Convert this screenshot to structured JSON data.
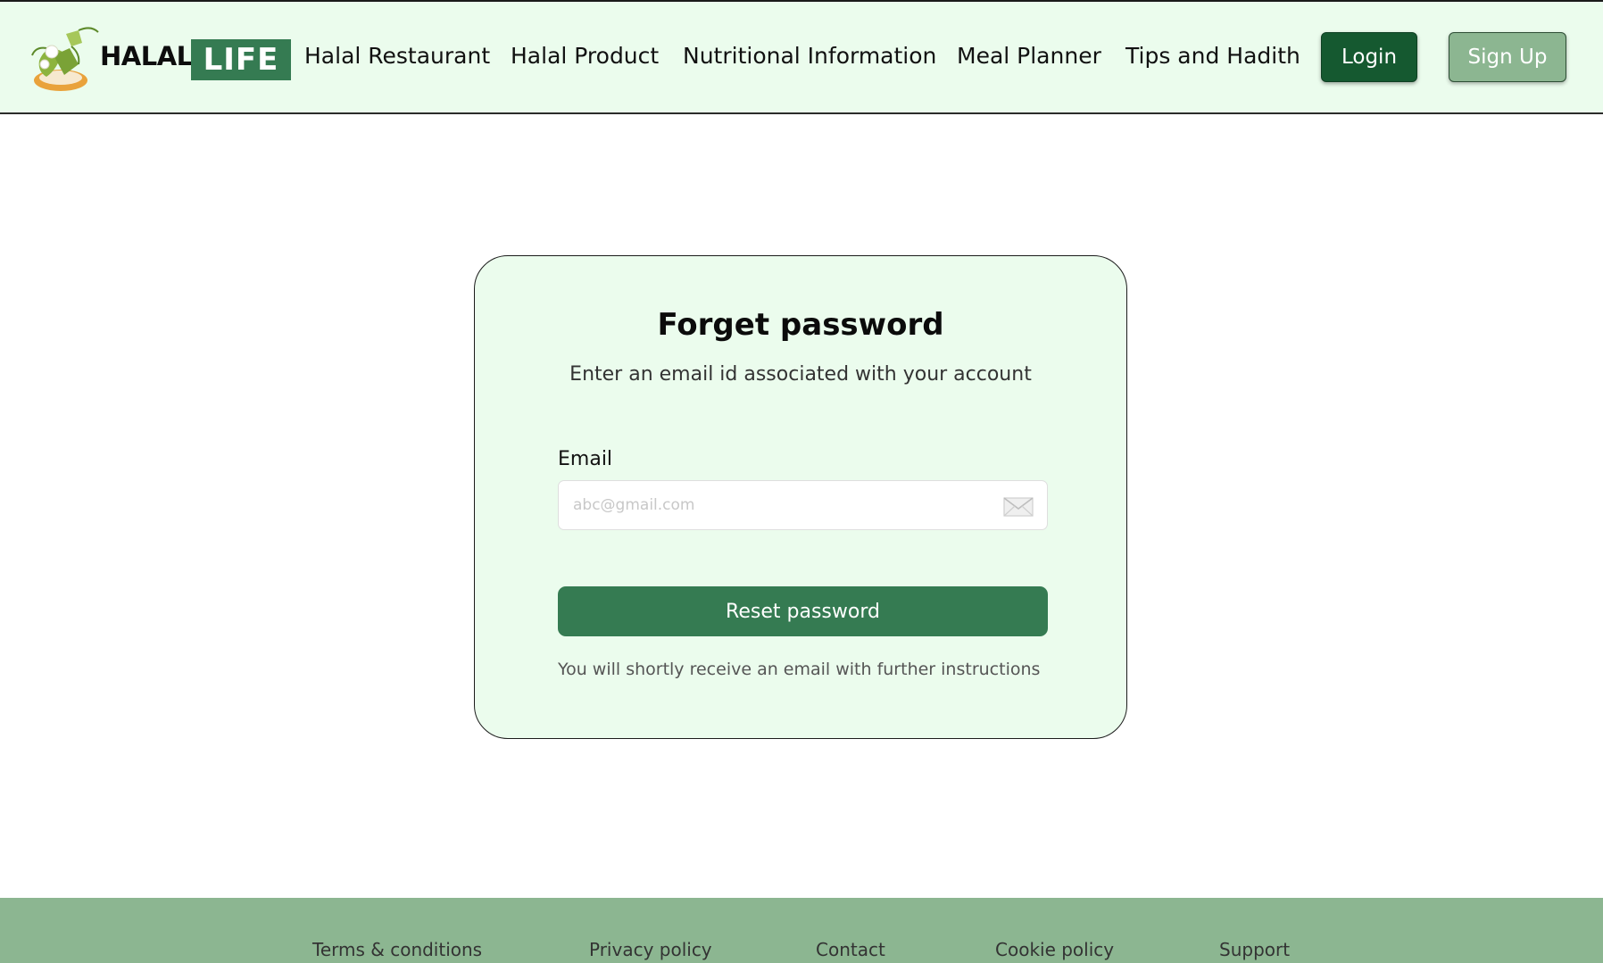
{
  "brand": {
    "word1": "HALAL",
    "word2": "LIFE",
    "colors": {
      "primary": "#357b52",
      "dark": "#155930",
      "light": "#8cb691",
      "background": "#ebfced"
    }
  },
  "nav": {
    "items": [
      {
        "label": "Halal Restaurant"
      },
      {
        "label": "Halal Product"
      },
      {
        "label": "Nutritional Information"
      },
      {
        "label": "Meal Planner"
      },
      {
        "label": "Tips and Hadith"
      }
    ],
    "login_label": "Login",
    "signup_label": "Sign Up"
  },
  "form": {
    "title": "Forget password",
    "subtitle": "Enter an email id associated with your account",
    "email_label": "Email",
    "email_placeholder": "abc@gmail.com",
    "email_value": "",
    "email_icon": "mail-icon",
    "submit_label": "Reset password",
    "note": "You will shortly receive an email with further instructions"
  },
  "footer": {
    "links": [
      {
        "label": "Terms & conditions"
      },
      {
        "label": "Privacy policy"
      },
      {
        "label": "Contact"
      },
      {
        "label": "Cookie policy"
      },
      {
        "label": "Support"
      }
    ]
  }
}
